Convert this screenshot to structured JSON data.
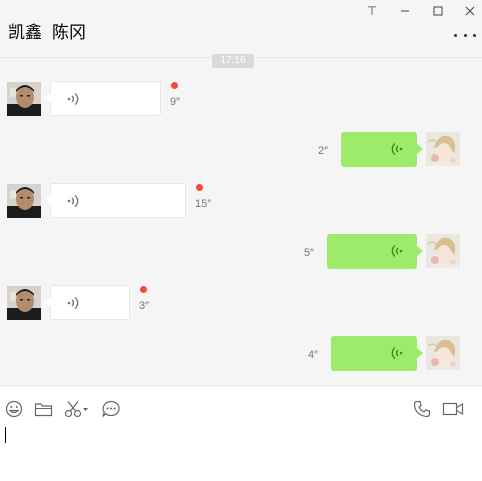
{
  "header": {
    "contact_name": "凯鑫",
    "contact_remark": "陈冈",
    "pin_glyph": "⊤"
  },
  "chat": {
    "timestamp": "17:16",
    "messages": [
      {
        "from": "other",
        "type": "voice",
        "duration": "9″",
        "unread": true
      },
      {
        "from": "me",
        "type": "voice",
        "duration": "2″"
      },
      {
        "from": "other",
        "type": "voice",
        "duration": "15″",
        "unread": true
      },
      {
        "from": "me",
        "type": "voice",
        "duration": "5″"
      },
      {
        "from": "other",
        "type": "voice",
        "duration": "3″",
        "unread": true
      },
      {
        "from": "me",
        "type": "voice",
        "duration": "4″"
      }
    ]
  },
  "colors": {
    "accent_green": "#9eea6a",
    "unread_dot": "#f04b3a",
    "background": "#f5f5f5"
  },
  "toolbar": {
    "left_icons": [
      "emoji-icon",
      "folder-icon",
      "scissors-icon",
      "chat-history-icon"
    ],
    "right_icons": [
      "phone-icon",
      "video-icon"
    ]
  },
  "input": {
    "value": ""
  }
}
